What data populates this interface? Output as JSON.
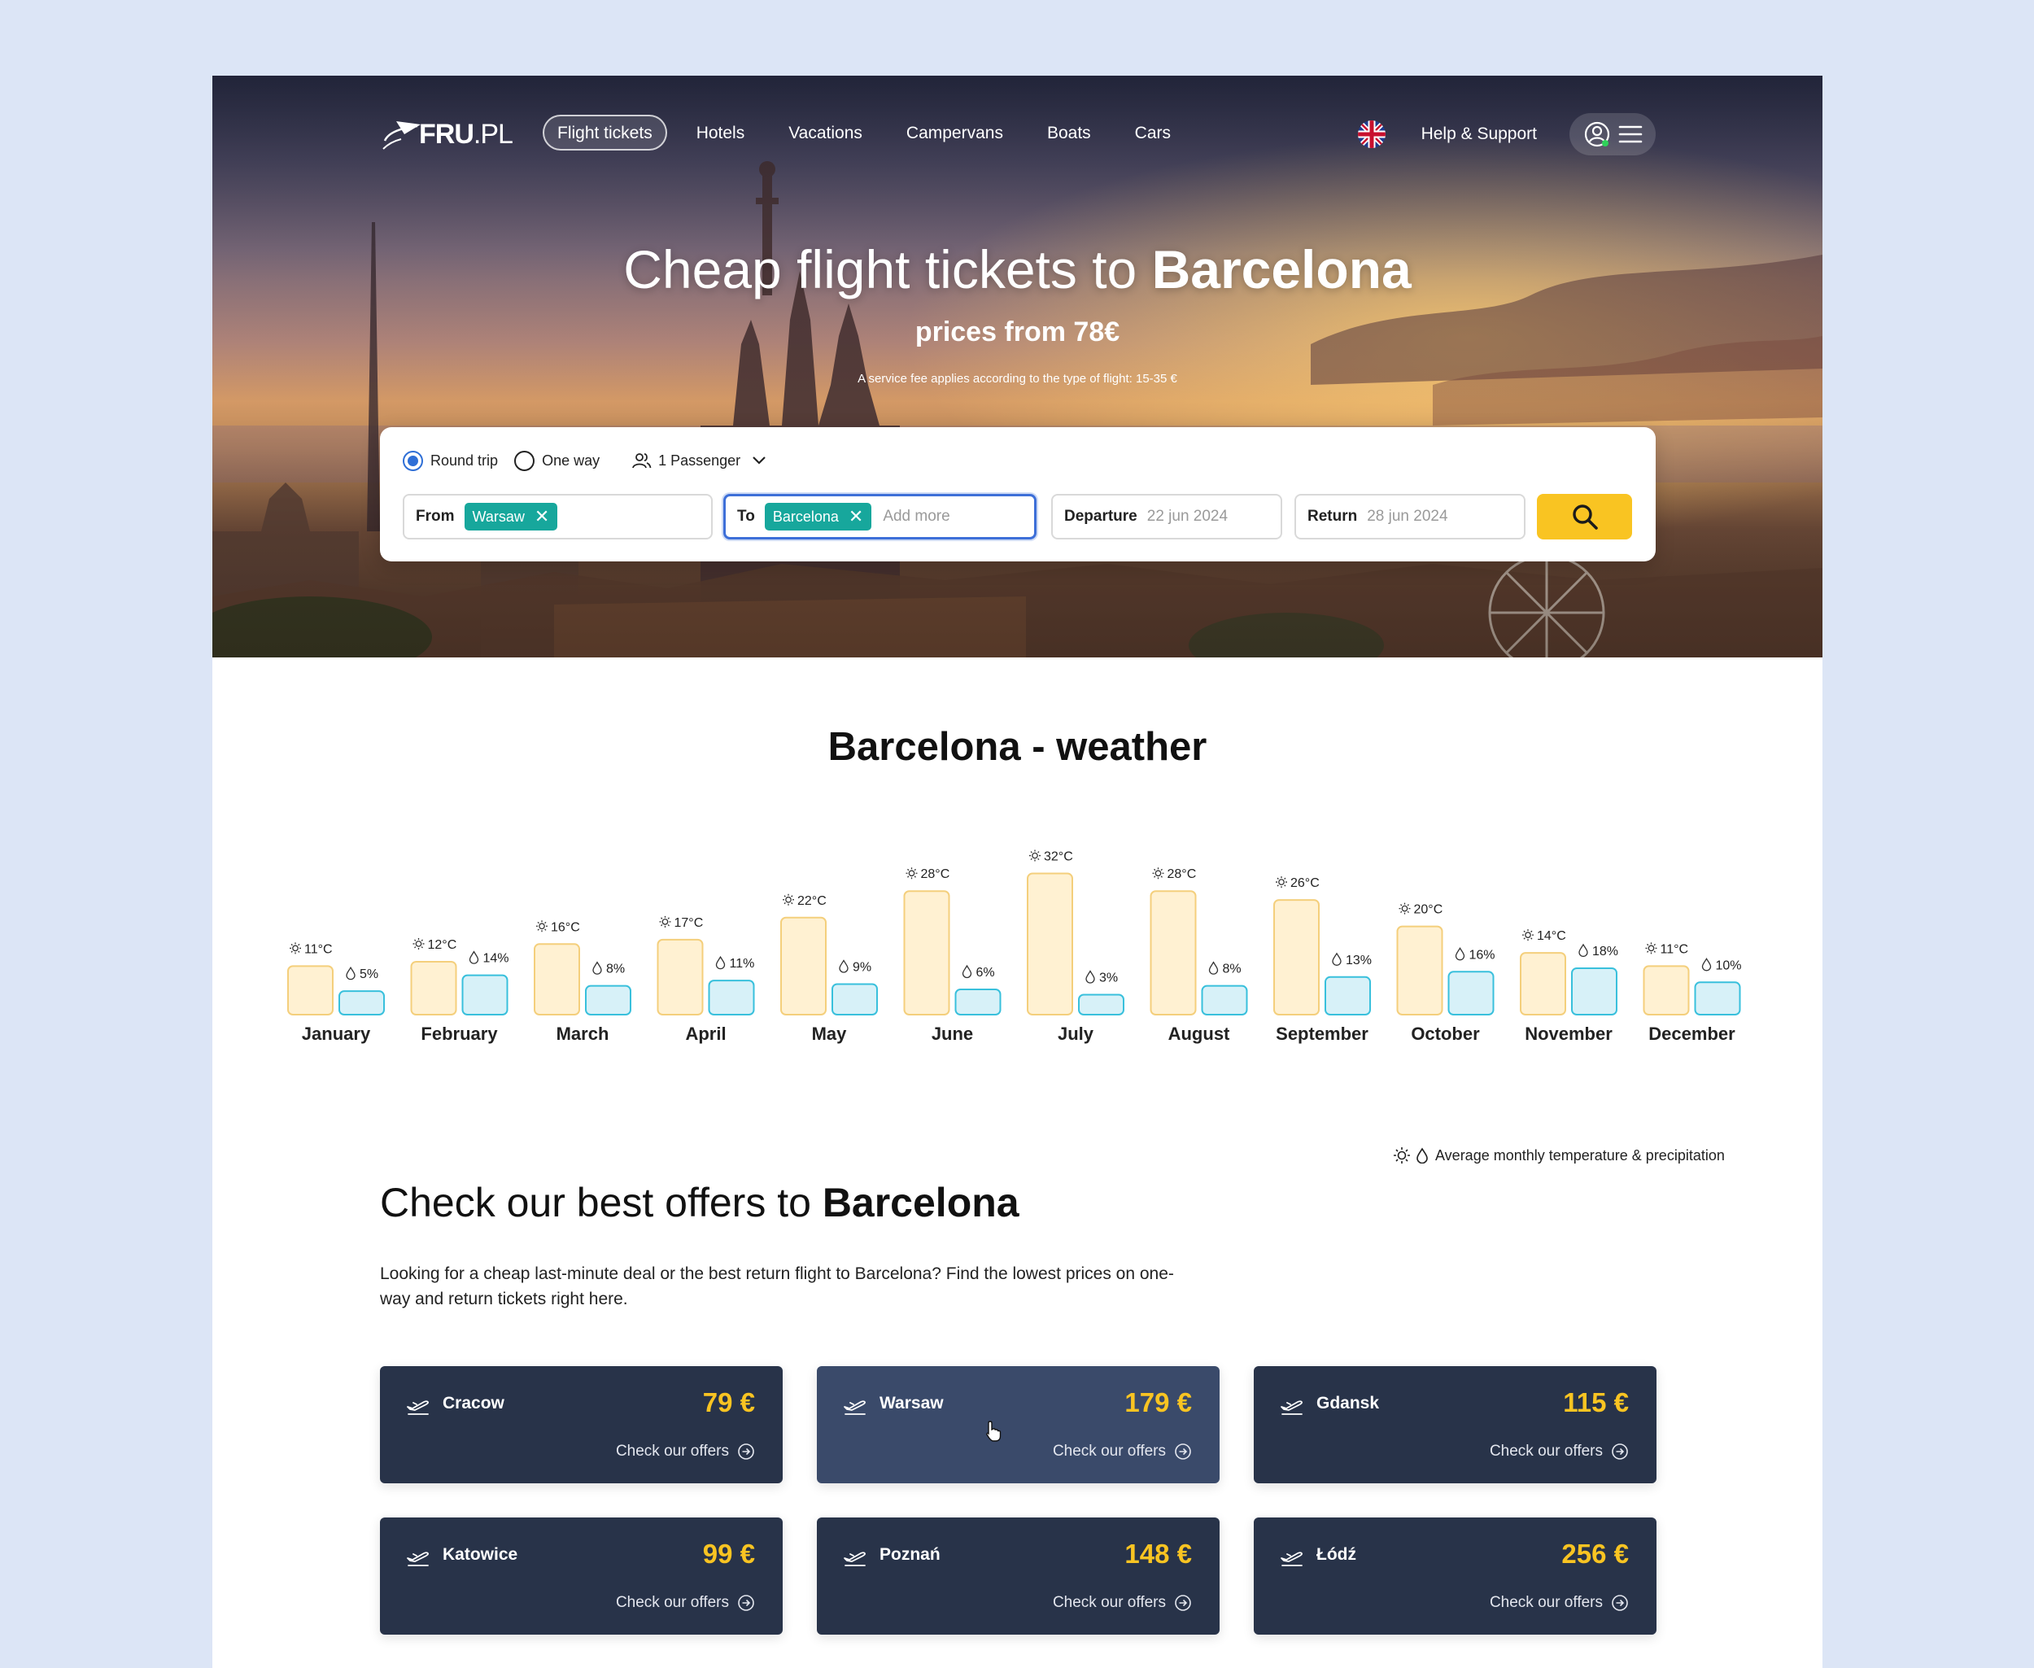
{
  "nav": {
    "logo_main": "FRU",
    "logo_suffix": ".PL",
    "links": [
      "Flight tickets",
      "Hotels",
      "Vacations",
      "Campervans",
      "Boats",
      "Cars"
    ],
    "help": "Help & Support",
    "language_icon": "uk-flag-icon"
  },
  "hero": {
    "title_prefix": "Cheap flight tickets to ",
    "title_city": "Barcelona",
    "subtitle": "prices from 78€",
    "fee_note": "A service fee applies according to the type of flight: 15-35 €"
  },
  "search": {
    "round_trip": "Round trip",
    "one_way": "One way",
    "passengers": "1 Passenger",
    "from_label": "From",
    "from_chip": "Warsaw",
    "to_label": "To",
    "to_chip": "Barcelona",
    "to_placeholder": "Add more",
    "departure_label": "Departure",
    "departure_value": "22 jun 2024",
    "return_label": "Return",
    "return_value": "28 jun 2024"
  },
  "weather": {
    "title": "Barcelona - weather",
    "legend": "Average monthly temperature & precipitation"
  },
  "chart_data": {
    "type": "bar",
    "categories": [
      "January",
      "February",
      "March",
      "April",
      "May",
      "June",
      "July",
      "August",
      "September",
      "October",
      "November",
      "December"
    ],
    "series": [
      {
        "name": "temperature",
        "unit": "°C",
        "values": [
          11,
          12,
          16,
          17,
          22,
          28,
          32,
          28,
          26,
          20,
          14,
          11
        ]
      },
      {
        "name": "precipitation",
        "unit": "%",
        "values": [
          5,
          14,
          8,
          11,
          9,
          6,
          3,
          8,
          13,
          16,
          18,
          10
        ]
      }
    ],
    "colors": {
      "temp_fill": "#fff1d2",
      "temp_stroke": "#f4cf7c",
      "prec_fill": "#d7f1f8",
      "prec_stroke": "#39c0dc"
    }
  },
  "offers": {
    "title_prefix": "Check our best offers to ",
    "title_city": "Barcelona",
    "description": "Looking for a cheap last-minute deal or the best return flight to Barcelona? Find the lowest prices on one-way and return tickets right here.",
    "check_label": "Check our offers",
    "cards": [
      {
        "city": "Cracow",
        "price": "79 €"
      },
      {
        "city": "Warsaw",
        "price": "179 €"
      },
      {
        "city": "Gdansk",
        "price": "115 €"
      },
      {
        "city": "Katowice",
        "price": "99 €"
      },
      {
        "city": "Poznań",
        "price": "148 €"
      },
      {
        "city": "Łódź",
        "price": "256 €"
      }
    ]
  }
}
